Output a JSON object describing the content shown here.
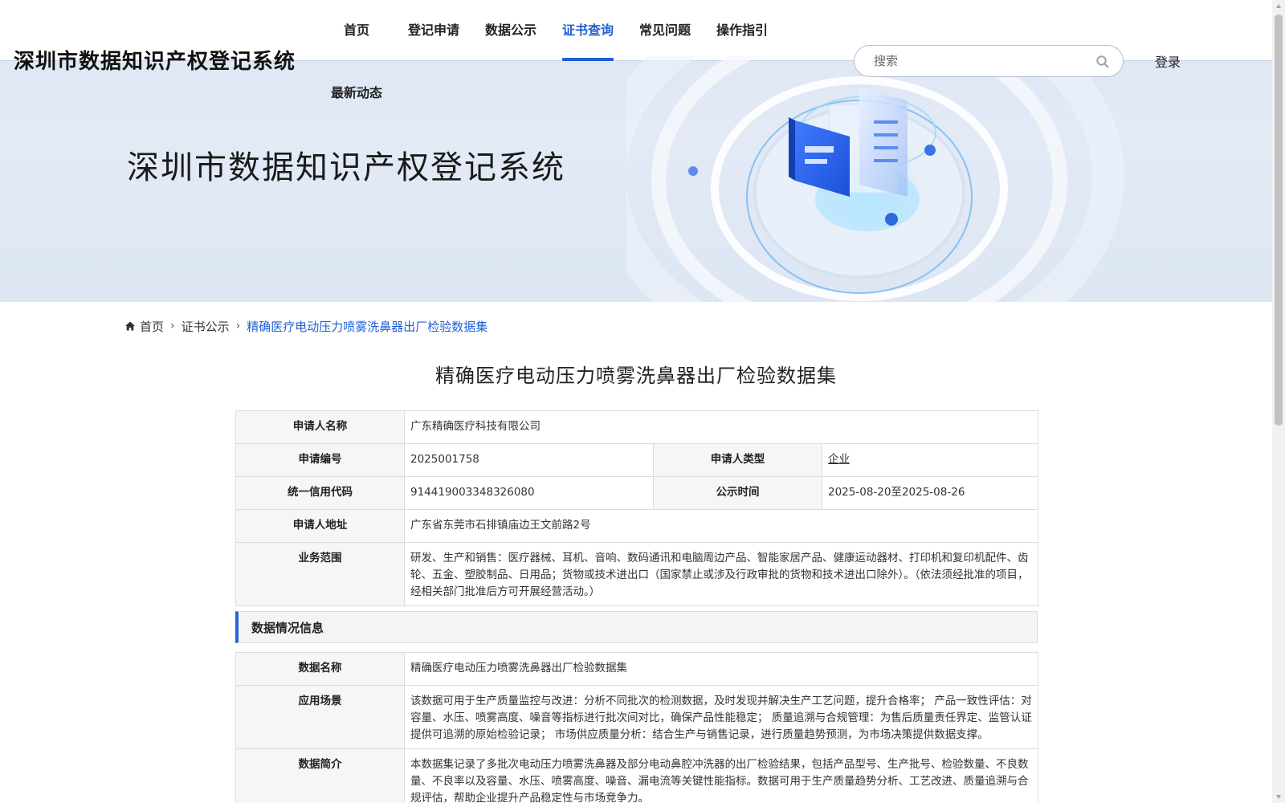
{
  "header": {
    "site_title": "深圳市数据知识产权登记系统",
    "nav": [
      {
        "label": "首页",
        "active": false
      },
      {
        "label": "登记申请",
        "active": false
      },
      {
        "label": "数据公示",
        "active": false
      },
      {
        "label": "证书查询",
        "active": true
      },
      {
        "label": "常见问题",
        "active": false
      },
      {
        "label": "操作指引",
        "active": false
      },
      {
        "label": "最新动态",
        "active": false
      }
    ],
    "search_placeholder": "搜索",
    "login_label": "登录",
    "accent_color": "#1f5fd6"
  },
  "hero": {
    "title": "深圳市数据知识产权登记系统"
  },
  "breadcrumb": {
    "home": "首页",
    "level2": "证书公示",
    "current": "精确医疗电动压力喷雾洗鼻器出厂检验数据集"
  },
  "detail": {
    "title": "精确医疗电动压力喷雾洗鼻器出厂检验数据集",
    "applicant_info": {
      "applicant_name_label": "申请人名称",
      "applicant_name": "广东精确医疗科技有限公司",
      "application_no_label": "申请编号",
      "application_no": "2025001758",
      "applicant_type_label": "申请人类型",
      "applicant_type": "企业",
      "credit_code_label": "统一信用代码",
      "credit_code": "914419003348326080",
      "publicity_time_label": "公示时间",
      "publicity_time": "2025-08-20至2025-08-26",
      "address_label": "申请人地址",
      "address": "广东省东莞市石排镇庙边王文前路2号",
      "business_scope_label": "业务范围",
      "business_scope": "研发、生产和销售：医疗器械、耳机、音响、数码通讯和电脑周边产品、智能家居产品、健康运动器材、打印机和复印机配件、齿轮、五金、塑胶制品、日用品；货物或技术进出口（国家禁止或涉及行政审批的货物和技术进出口除外）。（依法须经批准的项目，经相关部门批准后方可开展经营活动。）"
    },
    "data_section_title": "数据情况信息",
    "data_info": {
      "data_name_label": "数据名称",
      "data_name": "精确医疗电动压力喷雾洗鼻器出厂检验数据集",
      "scenario_label": "应用场景",
      "scenario": "该数据可用于生产质量监控与改进：分析不同批次的检测数据，及时发现并解决生产工艺问题，提升合格率； 产品一致性评估：对容量、水压、喷雾高度、噪音等指标进行批次间对比，确保产品性能稳定； 质量追溯与合规管理：为售后质量责任界定、监管认证提供可追溯的原始检验记录； 市场供应质量分析：结合生产与销售记录，进行质量趋势预测，为市场决策提供数据支撑。",
      "summary_label": "数据简介",
      "summary": "本数据集记录了多批次电动压力喷雾洗鼻器及部分电动鼻腔冲洗器的出厂检验结果，包括产品型号、生产批号、检验数量、不良数量、不良率以及容量、水压、喷雾高度、噪音、漏电流等关键性能指标。数据可用于生产质量趋势分析、工艺改进、质量追溯与合规评估，帮助企业提升产品稳定性与市场竞争力。"
    }
  }
}
